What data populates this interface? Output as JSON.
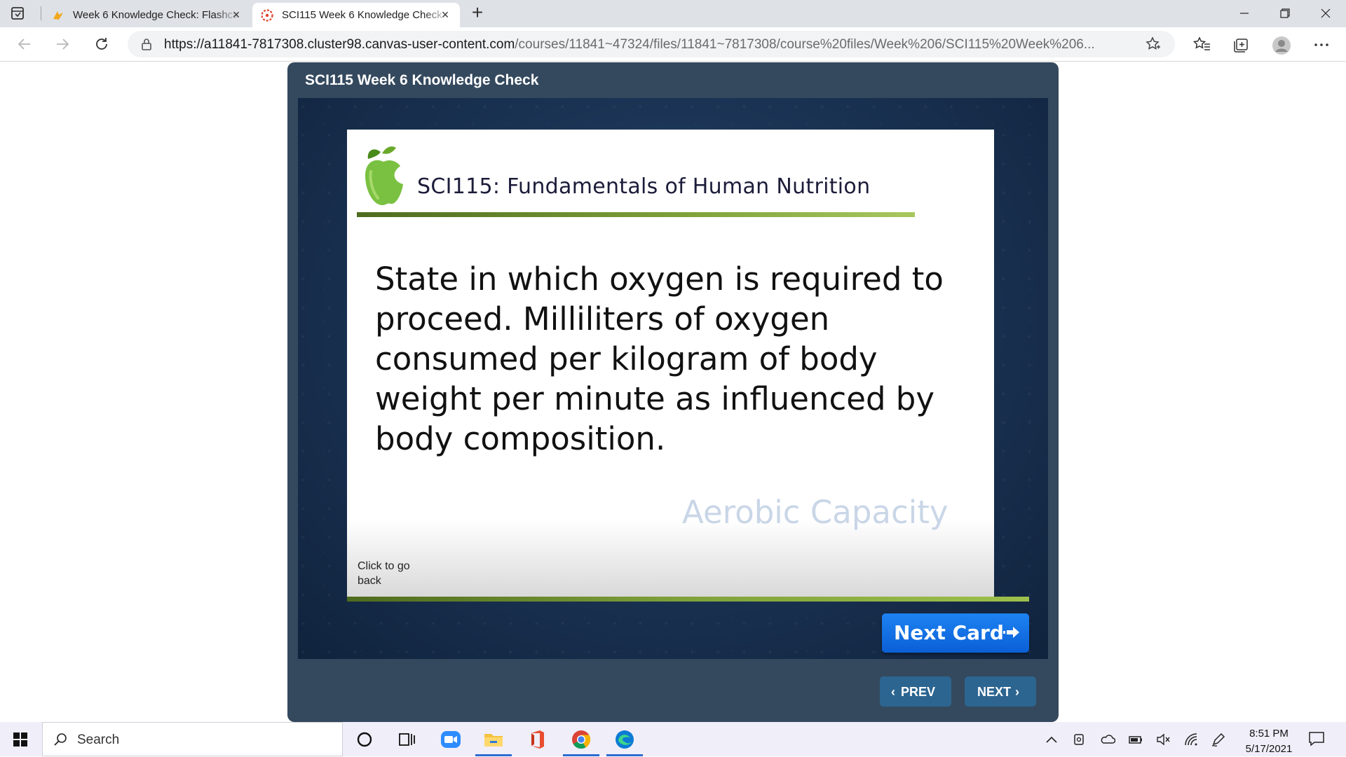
{
  "browser": {
    "tabs": [
      {
        "title": "Week 6 Knowledge Check: Flashcards",
        "active": false,
        "icon": "canvas-quizlet-icon"
      },
      {
        "title": "SCI115 Week 6 Knowledge Check",
        "active": true,
        "icon": "canvas-icon"
      }
    ],
    "url_host": "https://a11841-7817308.cluster98.canvas-user-content.com",
    "url_path": "/courses/11841~47324/files/11841~7817308/course%20files/Week%206/SCI115%20Week%206..."
  },
  "player": {
    "title": "SCI115 Week 6 Knowledge Check",
    "card": {
      "course_title": "SCI115: Fundamentals of Human Nutrition",
      "question": "State in which oxygen is required to proceed. Milliliters of oxygen consumed per kilogram of body weight per minute as influenced by body composition.",
      "answer": "Aerobic Capacity",
      "go_back_label": "Click to go back"
    },
    "next_card_label": "Next Card",
    "prev_label": "PREV",
    "next_label": "NEXT",
    "colors": {
      "frame": "#34495e",
      "accent_green": "#7fa23a",
      "next_card_blue": "#1d83f2",
      "nav_button": "#2c6590"
    }
  },
  "taskbar": {
    "search_label": "Search",
    "time": "8:51 PM",
    "date": "5/17/2021"
  }
}
